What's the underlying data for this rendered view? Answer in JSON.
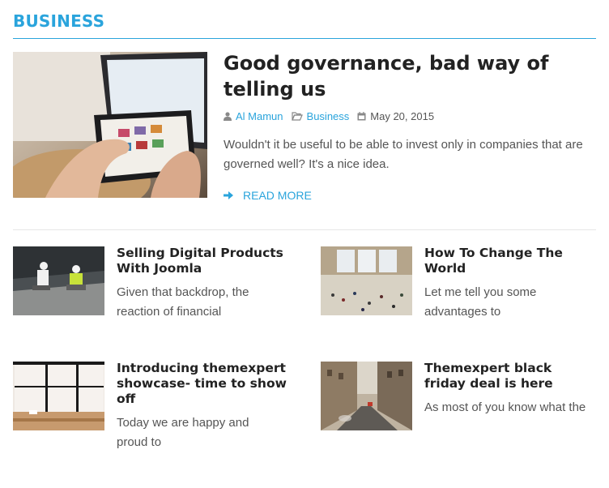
{
  "section": {
    "title": "BUSINESS"
  },
  "featured": {
    "title": "Good governance, bad way of telling us",
    "author": "Al Mamun",
    "category": "Business",
    "date": "May 20, 2015",
    "excerpt": "Wouldn't it be useful to be able to invest only in companies that are governed well? It's a nice idea.",
    "read_more": "READ MORE",
    "image": "tablet-icon"
  },
  "items": [
    {
      "title": "Selling Digital Products With Joomla",
      "excerpt": "Given that backdrop, the reaction of financial",
      "image": "workers-photo-icon"
    },
    {
      "title": "How To Change The World",
      "excerpt": "Let me tell you some advantages to",
      "image": "station-photo-icon"
    },
    {
      "title": "Introducing themexpert showcase- time to show off",
      "excerpt": "Today we are happy and proud to",
      "image": "office-photo-icon"
    },
    {
      "title": "Themexpert black friday deal is here",
      "excerpt": "As most of you know what the",
      "image": "street-photo-icon"
    }
  ],
  "colors": {
    "accent": "#2aa4dc",
    "title": "#222222",
    "text": "#555555"
  }
}
